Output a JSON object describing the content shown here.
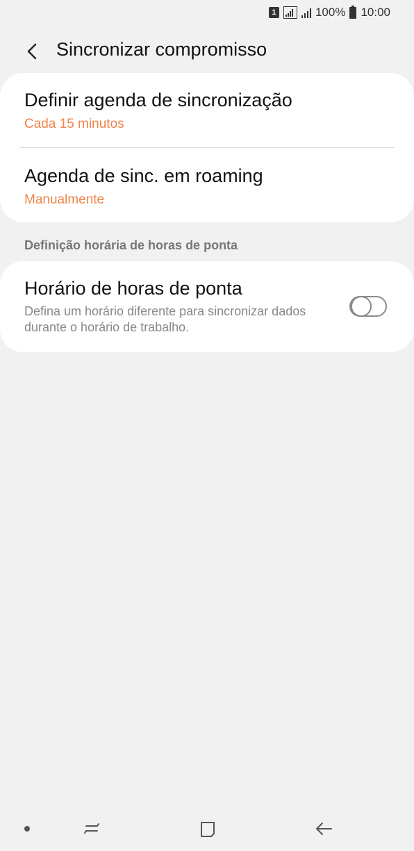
{
  "status_bar": {
    "sim_label": "1",
    "battery_text": "100%",
    "time": "10:00"
  },
  "header": {
    "title": "Sincronizar compromisso"
  },
  "sync_card": {
    "items": [
      {
        "title": "Definir agenda de sincronização",
        "value": "Cada 15 minutos"
      },
      {
        "title": "Agenda de sinc. em roaming",
        "value": "Manualmente"
      }
    ]
  },
  "peak_section": {
    "header": "Definição horária de horas de ponta",
    "item": {
      "title": "Horário de horas de ponta",
      "description": "Defina um horário diferente para sincronizar dados durante o horário de trabalho.",
      "toggle_on": false
    }
  },
  "colors": {
    "accent": "#f0844a",
    "background": "#f1f1f1",
    "card": "#ffffff"
  }
}
